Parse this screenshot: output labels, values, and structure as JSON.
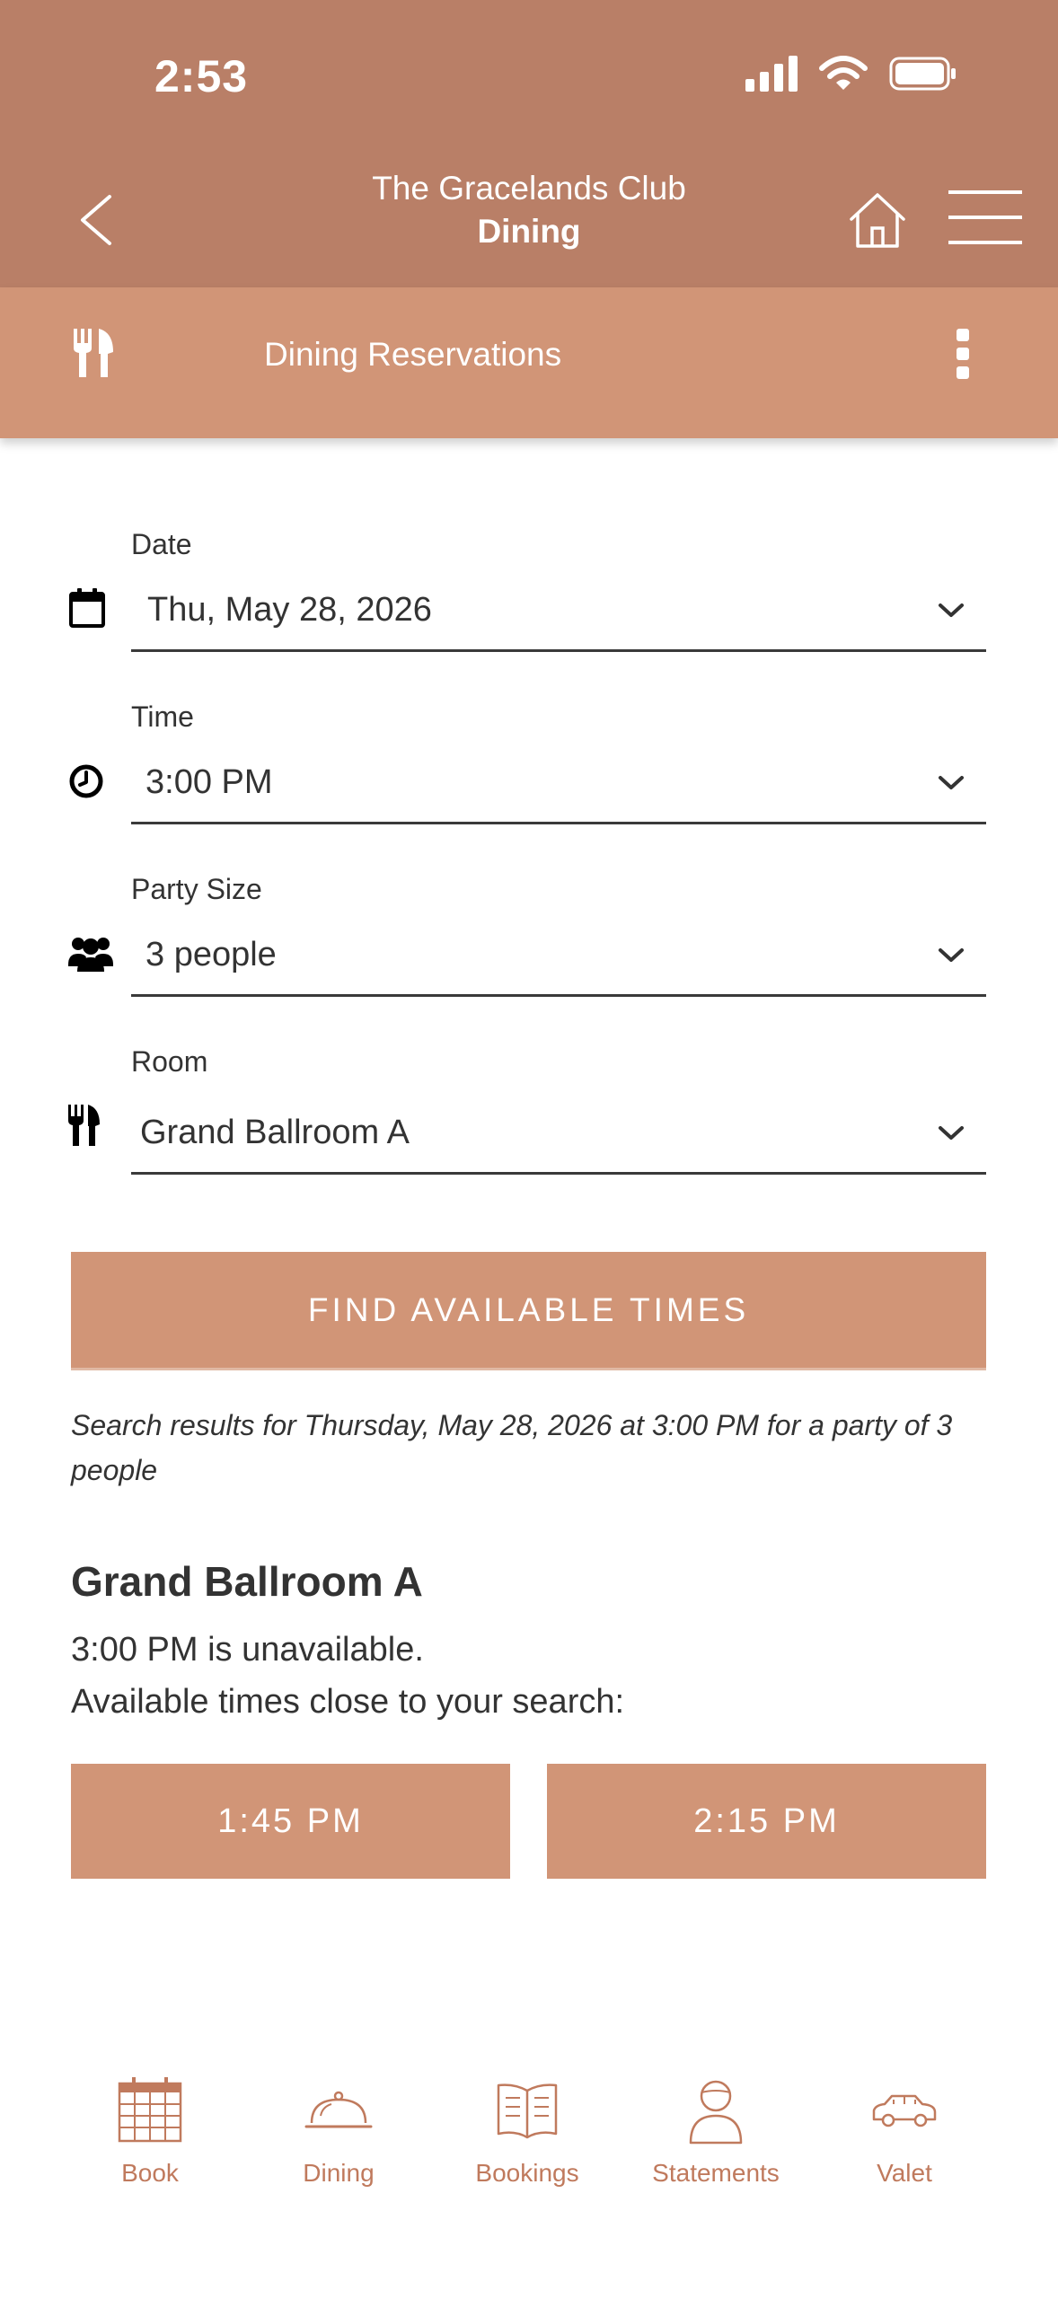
{
  "status_bar": {
    "time": "2:53",
    "icons": [
      "cellular-signal-icon",
      "wifi-icon",
      "battery-icon"
    ]
  },
  "header": {
    "club_name": "The Gracelands Club",
    "section": "Dining",
    "back_icon": "chevron-left-icon",
    "home_icon": "home-icon",
    "menu_icon": "hamburger-menu-icon"
  },
  "subheader": {
    "icon": "utensils-icon",
    "title": "Dining Reservations",
    "more_icon": "kebab-menu-icon"
  },
  "form": {
    "date": {
      "label": "Date",
      "value": "Thu, May 28, 2026",
      "icon": "calendar-icon"
    },
    "time": {
      "label": "Time",
      "value": "3:00 PM",
      "icon": "clock-icon"
    },
    "party_size": {
      "label": "Party Size",
      "value": "3 people",
      "icon": "users-icon"
    },
    "room": {
      "label": "Room",
      "value": "Grand Ballroom A",
      "icon": "utensils-icon"
    },
    "find_button": "FIND AVAILABLE TIMES"
  },
  "results": {
    "summary": "Search results for Thursday, May 28, 2026 at 3:00 PM for a party of 3 people",
    "room_name": "Grand Ballroom A",
    "unavailable_text": "3:00 PM is unavailable.",
    "alternatives_label": "Available times close to your search:",
    "slots": [
      "1:45 PM",
      "2:15 PM"
    ]
  },
  "bottom_nav": {
    "items": [
      {
        "label": "Book",
        "icon": "calendar-grid-icon"
      },
      {
        "label": "Dining",
        "icon": "cloche-icon"
      },
      {
        "label": "Bookings",
        "icon": "open-book-icon"
      },
      {
        "label": "Statements",
        "icon": "person-icon"
      },
      {
        "label": "Valet",
        "icon": "car-icon"
      }
    ]
  },
  "colors": {
    "header": "#b97f67",
    "subheader": "#d19577",
    "button": "#d19577",
    "nav_accent": "#c07a5d",
    "text": "#333333"
  }
}
